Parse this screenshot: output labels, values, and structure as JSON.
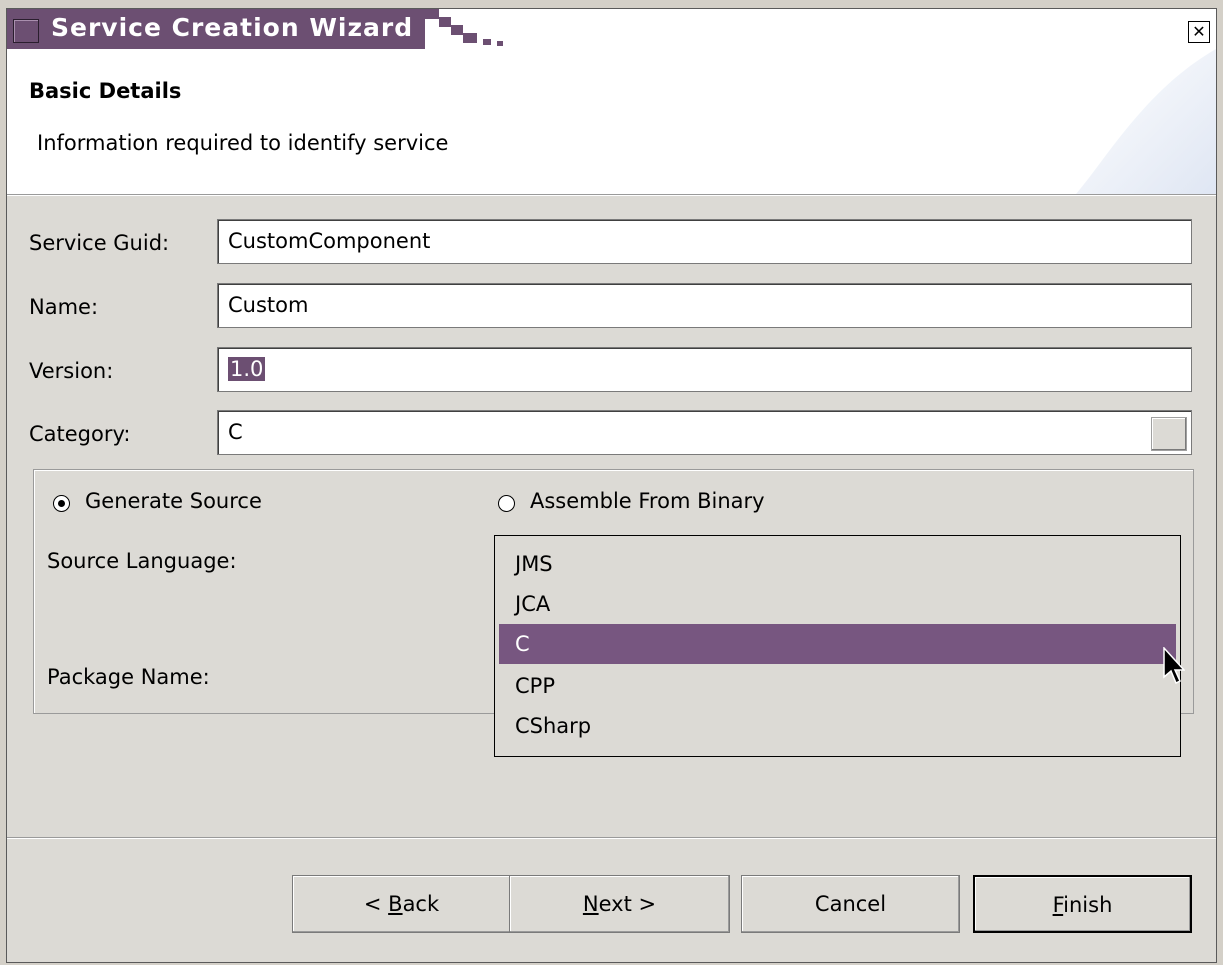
{
  "window": {
    "title": "Service Creation Wizard",
    "close_glyph": "✕"
  },
  "header": {
    "title": "Basic Details",
    "subtitle": "Information required to identify service"
  },
  "form": {
    "service_guid": {
      "label": "Service Guid:",
      "value": "CustomComponent"
    },
    "name": {
      "label": "Name:",
      "value": "Custom"
    },
    "version": {
      "label": "Version:",
      "value": "1.0"
    },
    "category": {
      "label": "Category:",
      "value": "C"
    }
  },
  "group": {
    "radio_generate": "Generate Source",
    "radio_assemble": "Assemble From Binary",
    "source_language_label": "Source Language:",
    "package_name_label": "Package Name:",
    "selected_radio": "Generate Source"
  },
  "dropdown": {
    "options": [
      "JMS",
      "JCA",
      "C",
      "CPP",
      "CSharp"
    ],
    "selected": "C"
  },
  "buttons": {
    "back": {
      "prefix": "< ",
      "mnemonic": "B",
      "rest": "ack"
    },
    "next": {
      "mnemonic": "N",
      "rest": "ext >"
    },
    "cancel": {
      "label": "Cancel"
    },
    "finish": {
      "mnemonic": "F",
      "rest": "inish"
    }
  },
  "colors": {
    "accent": "#6c4f72",
    "selection": "#775680",
    "dialog_bg": "#dcdad5"
  }
}
